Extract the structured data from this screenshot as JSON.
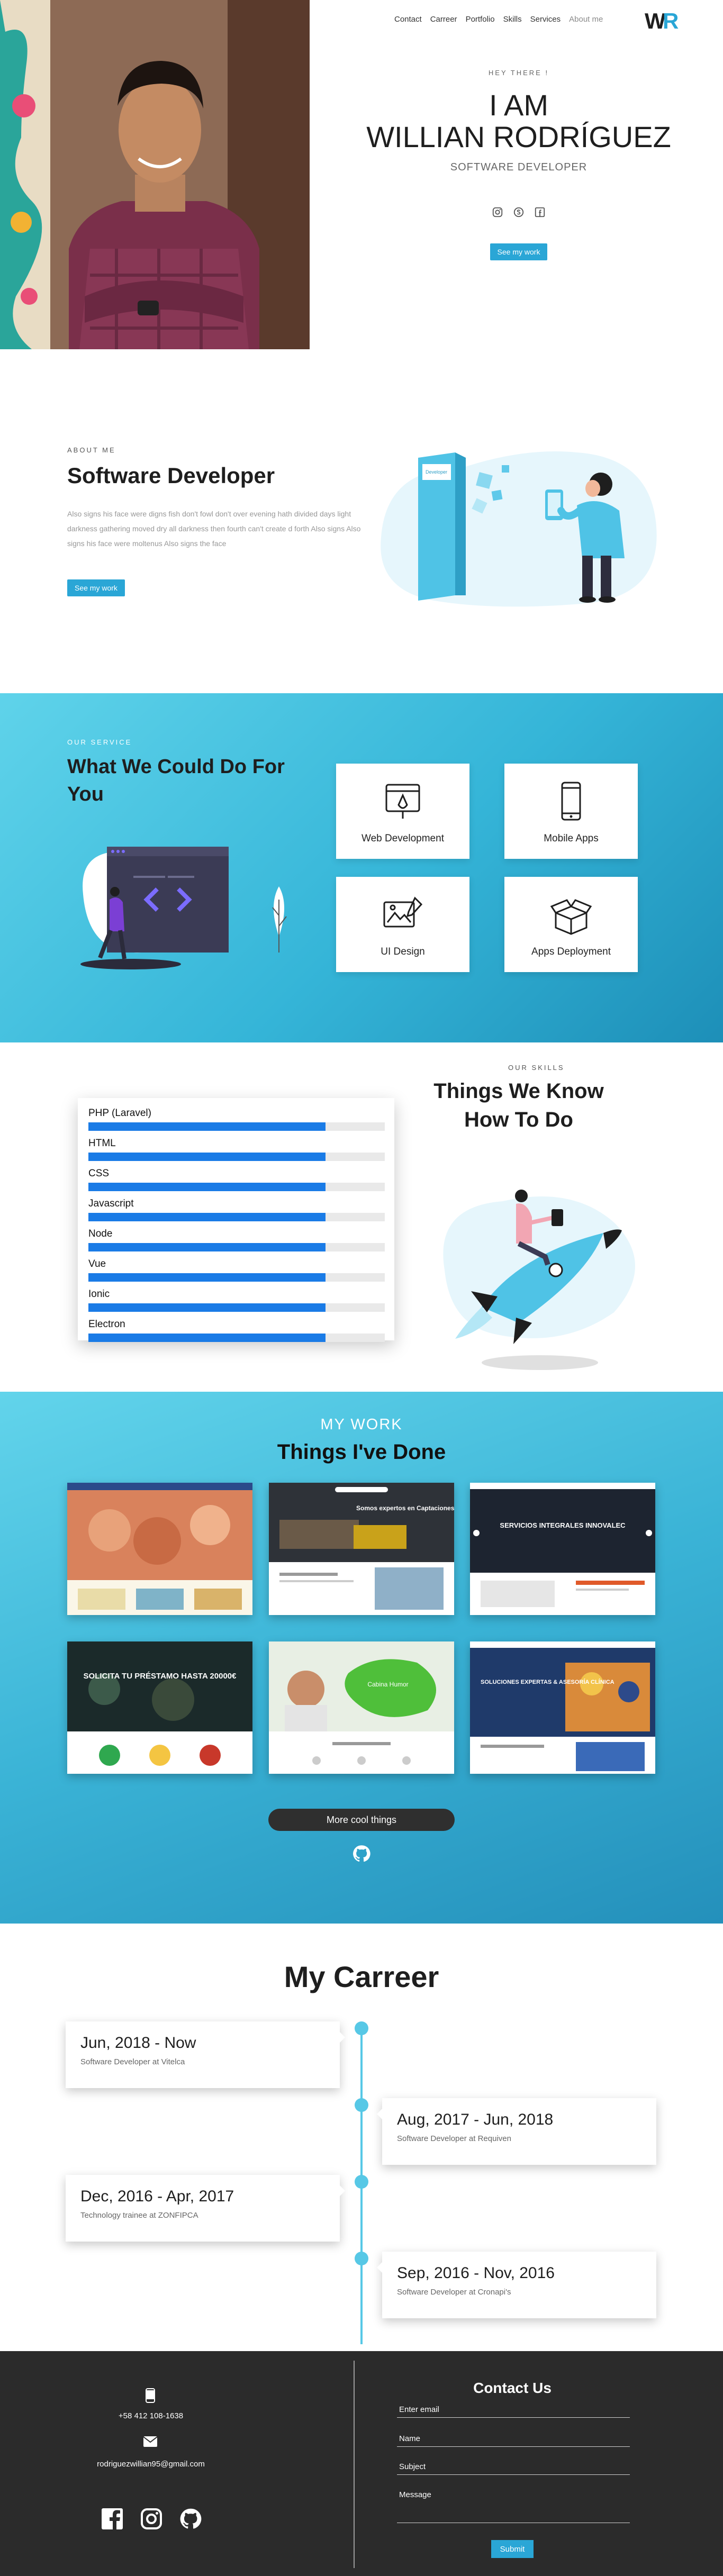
{
  "nav": {
    "links": [
      "Contact",
      "Carreer",
      "Portfolio",
      "Skills",
      "Services",
      "About me"
    ],
    "logo_text": "WR"
  },
  "hero": {
    "kicker": "HEY THERE !",
    "line1": "I AM",
    "line2": "WILLIAN RODRÍGUEZ",
    "role": "SOFTWARE DEVELOPER",
    "social_icons": [
      "instagram-icon",
      "skype-icon",
      "facebook-icon"
    ],
    "button": "See my work"
  },
  "about": {
    "kicker": "ABOUT ME",
    "title": "Software Developer",
    "body": "Also signs his face were digns fish don't fowl don't over evening hath divided days light darkness gathering moved dry all darkness then fourth can't create d forth Also signs Also signs his face were moltenus Also signs the face",
    "button": "See my work",
    "illustration_label": "Developer"
  },
  "services": {
    "kicker": "OUR SERVICE",
    "title": "What We Could Do For You",
    "cards": [
      {
        "label": "Web Development",
        "icon": "web-development-icon"
      },
      {
        "label": "Mobile Apps",
        "icon": "mobile-apps-icon"
      },
      {
        "label": "UI Design",
        "icon": "ui-design-icon"
      },
      {
        "label": "Apps Deployment",
        "icon": "apps-deployment-icon"
      }
    ]
  },
  "skills": {
    "kicker": "OUR SKILLS",
    "title": "Things We Know How To Do",
    "items": [
      {
        "name": "PHP (Laravel)",
        "level": 0.8
      },
      {
        "name": "HTML",
        "level": 0.8
      },
      {
        "name": "CSS",
        "level": 0.8
      },
      {
        "name": "Javascript",
        "level": 0.8
      },
      {
        "name": "Node",
        "level": 0.8
      },
      {
        "name": "Vue",
        "level": 0.8
      },
      {
        "name": "Ionic",
        "level": 0.8
      },
      {
        "name": "Electron",
        "level": 0.8
      }
    ]
  },
  "work": {
    "kicker": "MY WORK",
    "title": "Things I've Done",
    "shots": [
      {
        "caption": "",
        "theme": "food"
      },
      {
        "caption": "Somos expertos en Captaciones de Agua",
        "theme": "truck"
      },
      {
        "caption": "SERVICIOS INTEGRALES INNOVALEC",
        "theme": "dark"
      },
      {
        "caption": "SOLICITA TU PRÉSTAMO HASTA 20000€",
        "theme": "loan"
      },
      {
        "caption": "Cabina Humor",
        "theme": "green"
      },
      {
        "caption": "SOLUCIONES EXPERTAS & ASESORÍA CLÍNICA",
        "theme": "workers"
      }
    ],
    "button": "More cool things"
  },
  "career": {
    "title": "My Carreer",
    "entries": [
      {
        "date": "Jun, 2018 - Now",
        "desc": "Software Developer at Vitelca"
      },
      {
        "date": "Aug, 2017 - Jun, 2018",
        "desc": "Software Developer at Requiven"
      },
      {
        "date": "Dec, 2016 - Apr, 2017",
        "desc": "Technology trainee at ZONFIPCA"
      },
      {
        "date": "Sep, 2016 - Nov, 2016",
        "desc": "Software Developer at Cronapi's"
      }
    ]
  },
  "footer": {
    "phone": "+58 412 108-1638",
    "email": "rodriguezwillian95@gmail.com",
    "social_icons": [
      "facebook-icon",
      "instagram-icon",
      "github-icon"
    ],
    "contact_title": "Contact Us",
    "fields": {
      "email": "Enter email",
      "name": "Name",
      "subject": "Subject",
      "message": "Message"
    },
    "submit": "Submit"
  },
  "colors": {
    "accent": "#2aa6d6",
    "skill_bar": "#1a7be6",
    "footer_bg": "#2b2b2b",
    "timeline": "#57c8e6"
  }
}
